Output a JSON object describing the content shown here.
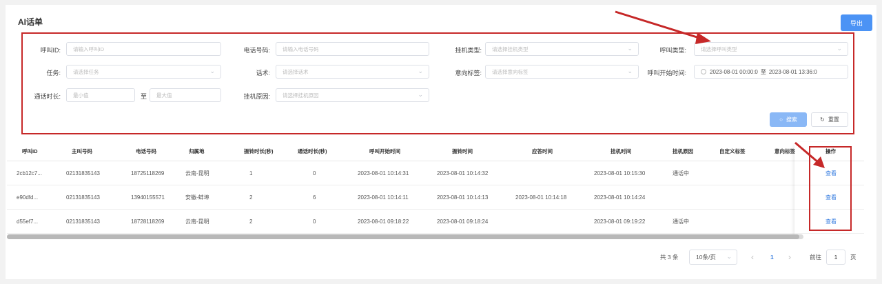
{
  "page": {
    "title": "AI话单",
    "export_label": "导出"
  },
  "filters": {
    "call_id": {
      "label": "呼叫ID:",
      "placeholder": "请输入呼叫ID"
    },
    "phone": {
      "label": "电话号码:",
      "placeholder": "请输入电话号码"
    },
    "hangup_type": {
      "label": "挂机类型:",
      "placeholder": "请选择挂机类型"
    },
    "call_type": {
      "label": "呼叫类型:",
      "placeholder": "请选择呼叫类型"
    },
    "task": {
      "label": "任务:",
      "placeholder": "请选择任务"
    },
    "script": {
      "label": "话术:",
      "placeholder": "请选择话术"
    },
    "intent_tag": {
      "label": "意向标签:",
      "placeholder": "请选择意向标签"
    },
    "call_start_time": {
      "label": "呼叫开始时间:",
      "start": "2023-08-01 00:00:0",
      "separator": "至",
      "end": "2023-08-01 13:36:0"
    },
    "duration": {
      "label": "通话时长:",
      "min_placeholder": "最小值",
      "separator": "至",
      "max_placeholder": "最大值"
    },
    "hangup_reason": {
      "label": "挂机原因:",
      "placeholder": "请选择挂机原因"
    },
    "search_label": "搜索",
    "reset_label": "重置"
  },
  "table": {
    "columns": [
      "呼叫ID",
      "主叫号码",
      "电话号码",
      "归属地",
      "振铃时长(秒)",
      "通话时长(秒)",
      "呼叫开始时间",
      "振铃时间",
      "应答时间",
      "挂机时间",
      "挂机原因",
      "自定义标签",
      "意向标签",
      "操作"
    ],
    "rows": [
      [
        "2cb12c7...",
        "02131835143",
        "18725118269",
        "云南-昆明",
        "1",
        "0",
        "2023-08-01 10:14:31",
        "2023-08-01 10:14:32",
        "",
        "2023-08-01 10:15:30",
        "通话中",
        "",
        "",
        "查看"
      ],
      [
        "e90dfd...",
        "02131835143",
        "13940155571",
        "安徽-蚌埠",
        "2",
        "6",
        "2023-08-01 10:14:11",
        "2023-08-01 10:14:13",
        "2023-08-01 10:14:18",
        "2023-08-01 10:14:24",
        "",
        "",
        "",
        "查看"
      ],
      [
        "d55ef7...",
        "02131835143",
        "18728118269",
        "云南-昆明",
        "2",
        "0",
        "2023-08-01 09:18:22",
        "2023-08-01 09:18:24",
        "",
        "2023-08-01 09:19:22",
        "通话中",
        "",
        "",
        "查看"
      ]
    ]
  },
  "pagination": {
    "total_label": "共 3 条",
    "page_size": "10条/页",
    "prev": "‹",
    "current_page": "1",
    "next": "›",
    "goto_label": "前往",
    "goto_value": "1",
    "page_suffix": "页"
  },
  "colors": {
    "accent": "#4b93f5",
    "annotation": "#c62828",
    "link": "#3a7fe0"
  }
}
